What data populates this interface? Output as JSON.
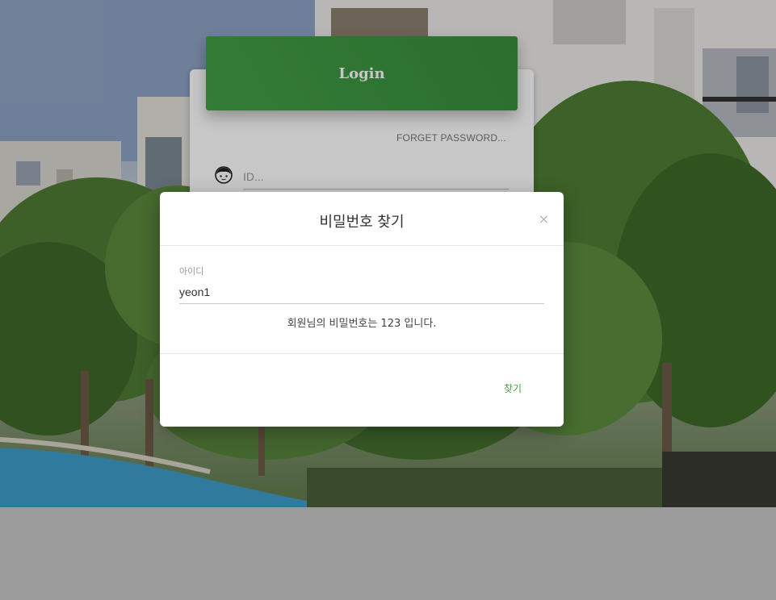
{
  "login": {
    "title": "Login",
    "forget_password": "FORGET PASSWORD...",
    "id_placeholder": "ID..."
  },
  "modal": {
    "title": "비밀번호 찾기",
    "close_symbol": "×",
    "id_label": "아이디",
    "id_value": "yeon1",
    "result_message": "회원님의 비밀번호는 123 입니다.",
    "find_button": "찾기"
  },
  "colors": {
    "accent_green": "#43a047",
    "overlay": "rgba(0,0,0,0.22)"
  },
  "icons": {
    "face": "face-icon",
    "close": "close-icon"
  }
}
